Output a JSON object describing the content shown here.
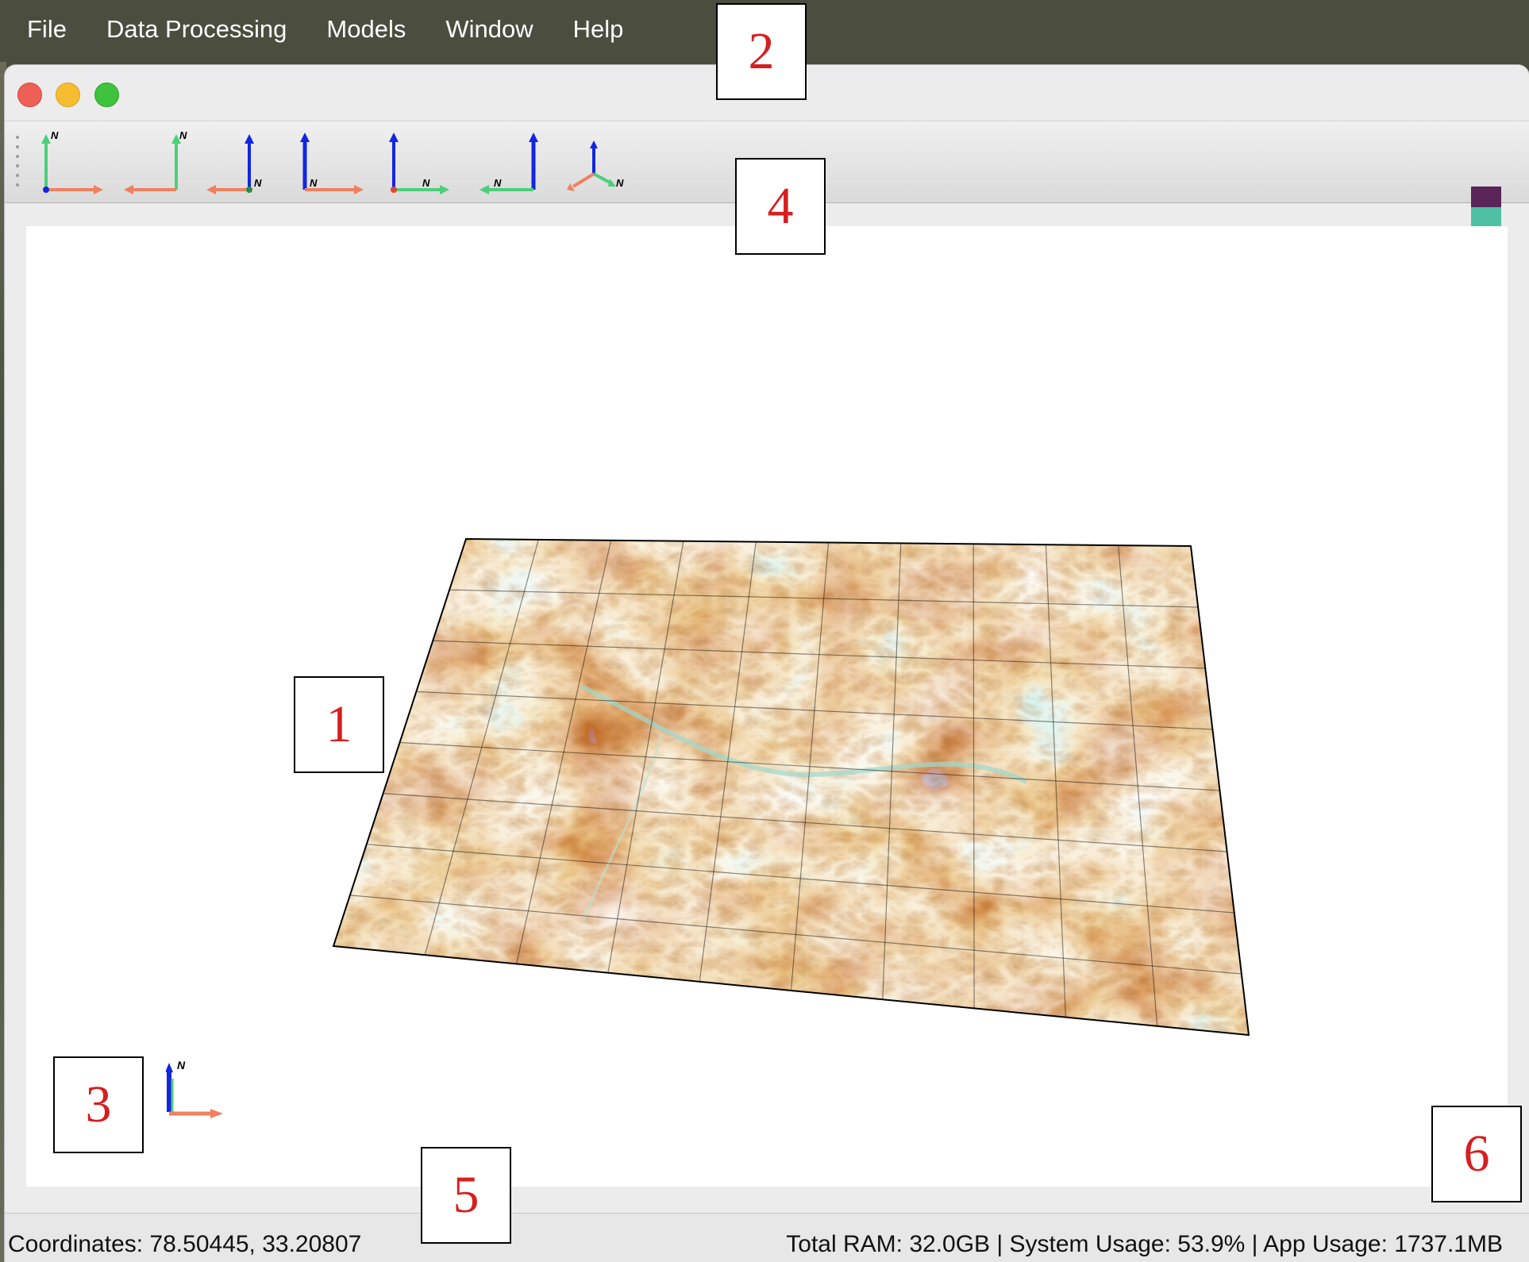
{
  "menubar": {
    "items": [
      "File",
      "Data Processing",
      "Models",
      "Window",
      "Help"
    ]
  },
  "window": {
    "controls": [
      "close",
      "minimize",
      "maximize"
    ]
  },
  "toolbar": {
    "view_buttons": [
      {
        "name": "view-north-up-left-icon",
        "axis_label": "N"
      },
      {
        "name": "view-north-up-right-icon",
        "axis_label": "N"
      },
      {
        "name": "view-north-right-icon",
        "axis_label": "N"
      },
      {
        "name": "view-north-down-icon",
        "axis_label": "N"
      },
      {
        "name": "view-north-east-icon",
        "axis_label": "N"
      },
      {
        "name": "view-north-west-icon",
        "axis_label": "N"
      },
      {
        "name": "view-isometric-icon",
        "axis_label": "N"
      }
    ],
    "colormap_swatch": [
      "#5a2558",
      "#4fc0a4",
      "#f39a2c"
    ],
    "axis_colors": {
      "x": "#f08060",
      "y": "#4ccf7a",
      "z": "#1226e0"
    }
  },
  "viewport": {
    "mini_axes_label": "N",
    "terrain_colormap": [
      "#7a1800",
      "#a83c0a",
      "#c97a22",
      "#e3c070",
      "#a6dccb",
      "#2f9ac8",
      "#0b3f9a"
    ]
  },
  "statusbar": {
    "coordinates": "Coordinates: 78.50445, 33.20807",
    "system_info": "Total RAM: 32.0GB | System Usage: 53.9% | App Usage: 1737.1MB"
  },
  "callouts": [
    "1",
    "2",
    "3",
    "4",
    "5",
    "6"
  ]
}
